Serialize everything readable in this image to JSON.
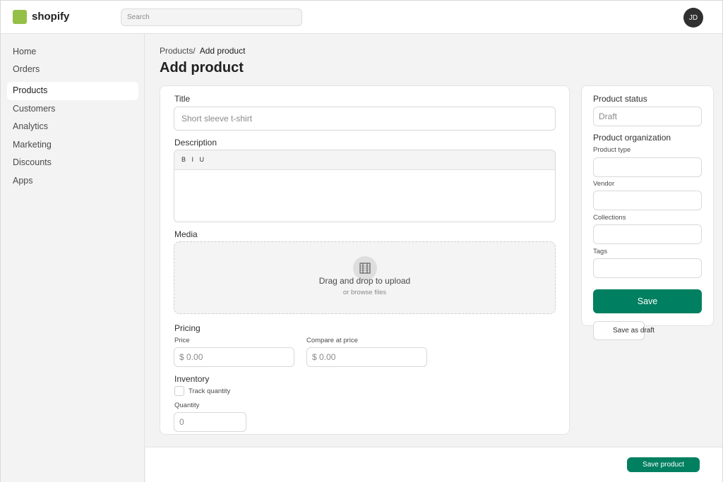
{
  "brand": {
    "name": "shopify",
    "logo_color": "#95bf47"
  },
  "search": {
    "placeholder": "Search"
  },
  "user": {
    "initials": "JD"
  },
  "sidebar": {
    "items": [
      {
        "label": "Home"
      },
      {
        "label": "Orders"
      },
      {
        "label": "Products",
        "active": true
      },
      {
        "label": "Customers"
      },
      {
        "label": "Analytics"
      },
      {
        "label": "Marketing"
      },
      {
        "label": "Discounts"
      },
      {
        "label": "Apps"
      }
    ]
  },
  "breadcrumb": {
    "parent": "Products/",
    "current": "Add product"
  },
  "page": {
    "title": "Add product"
  },
  "form": {
    "title": {
      "label": "Title",
      "placeholder": "Short sleeve t-shirt"
    },
    "description": {
      "label": "Description",
      "toolbar": "B I U"
    },
    "media": {
      "label": "Media",
      "upload_title": "Drag and drop to upload",
      "upload_sub": "or browse files"
    },
    "pricing": {
      "label": "Pricing",
      "price": {
        "label": "Price",
        "placeholder": "$ 0.00"
      },
      "compare": {
        "label": "Compare at price",
        "placeholder": "$ 0.00"
      }
    },
    "inventory": {
      "label": "Inventory",
      "track_label": "Track quantity",
      "quantity": {
        "label": "Quantity",
        "placeholder": "0"
      }
    }
  },
  "side": {
    "status": {
      "label": "Product status",
      "value": "Draft"
    },
    "organization": {
      "label": "Product organization",
      "type_label": "Product type",
      "vendor_label": "Vendor",
      "collections_label": "Collections",
      "tags_label": "Tags"
    },
    "save_label": "Save",
    "save_draft_label": "Save as draft"
  },
  "footer": {
    "save_product_label": "Save product"
  },
  "colors": {
    "primary": "#008060",
    "background": "#f3f3f3"
  }
}
